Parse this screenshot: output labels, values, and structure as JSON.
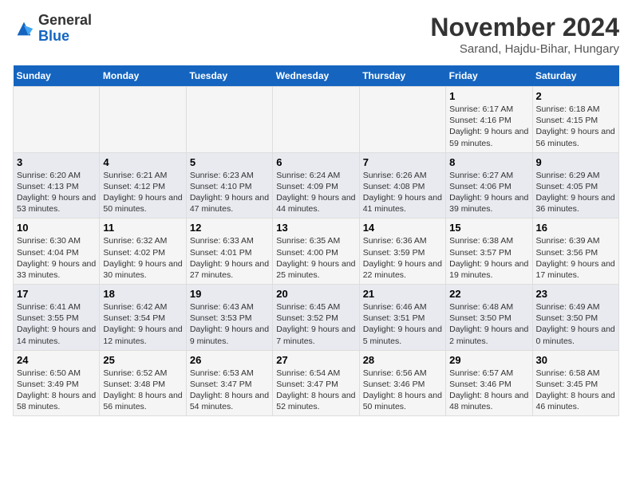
{
  "logo": {
    "general": "General",
    "blue": "Blue"
  },
  "header": {
    "month": "November 2024",
    "location": "Sarand, Hajdu-Bihar, Hungary"
  },
  "weekdays": [
    "Sunday",
    "Monday",
    "Tuesday",
    "Wednesday",
    "Thursday",
    "Friday",
    "Saturday"
  ],
  "weeks": [
    [
      {
        "day": "",
        "info": ""
      },
      {
        "day": "",
        "info": ""
      },
      {
        "day": "",
        "info": ""
      },
      {
        "day": "",
        "info": ""
      },
      {
        "day": "",
        "info": ""
      },
      {
        "day": "1",
        "info": "Sunrise: 6:17 AM\nSunset: 4:16 PM\nDaylight: 9 hours and 59 minutes."
      },
      {
        "day": "2",
        "info": "Sunrise: 6:18 AM\nSunset: 4:15 PM\nDaylight: 9 hours and 56 minutes."
      }
    ],
    [
      {
        "day": "3",
        "info": "Sunrise: 6:20 AM\nSunset: 4:13 PM\nDaylight: 9 hours and 53 minutes."
      },
      {
        "day": "4",
        "info": "Sunrise: 6:21 AM\nSunset: 4:12 PM\nDaylight: 9 hours and 50 minutes."
      },
      {
        "day": "5",
        "info": "Sunrise: 6:23 AM\nSunset: 4:10 PM\nDaylight: 9 hours and 47 minutes."
      },
      {
        "day": "6",
        "info": "Sunrise: 6:24 AM\nSunset: 4:09 PM\nDaylight: 9 hours and 44 minutes."
      },
      {
        "day": "7",
        "info": "Sunrise: 6:26 AM\nSunset: 4:08 PM\nDaylight: 9 hours and 41 minutes."
      },
      {
        "day": "8",
        "info": "Sunrise: 6:27 AM\nSunset: 4:06 PM\nDaylight: 9 hours and 39 minutes."
      },
      {
        "day": "9",
        "info": "Sunrise: 6:29 AM\nSunset: 4:05 PM\nDaylight: 9 hours and 36 minutes."
      }
    ],
    [
      {
        "day": "10",
        "info": "Sunrise: 6:30 AM\nSunset: 4:04 PM\nDaylight: 9 hours and 33 minutes."
      },
      {
        "day": "11",
        "info": "Sunrise: 6:32 AM\nSunset: 4:02 PM\nDaylight: 9 hours and 30 minutes."
      },
      {
        "day": "12",
        "info": "Sunrise: 6:33 AM\nSunset: 4:01 PM\nDaylight: 9 hours and 27 minutes."
      },
      {
        "day": "13",
        "info": "Sunrise: 6:35 AM\nSunset: 4:00 PM\nDaylight: 9 hours and 25 minutes."
      },
      {
        "day": "14",
        "info": "Sunrise: 6:36 AM\nSunset: 3:59 PM\nDaylight: 9 hours and 22 minutes."
      },
      {
        "day": "15",
        "info": "Sunrise: 6:38 AM\nSunset: 3:57 PM\nDaylight: 9 hours and 19 minutes."
      },
      {
        "day": "16",
        "info": "Sunrise: 6:39 AM\nSunset: 3:56 PM\nDaylight: 9 hours and 17 minutes."
      }
    ],
    [
      {
        "day": "17",
        "info": "Sunrise: 6:41 AM\nSunset: 3:55 PM\nDaylight: 9 hours and 14 minutes."
      },
      {
        "day": "18",
        "info": "Sunrise: 6:42 AM\nSunset: 3:54 PM\nDaylight: 9 hours and 12 minutes."
      },
      {
        "day": "19",
        "info": "Sunrise: 6:43 AM\nSunset: 3:53 PM\nDaylight: 9 hours and 9 minutes."
      },
      {
        "day": "20",
        "info": "Sunrise: 6:45 AM\nSunset: 3:52 PM\nDaylight: 9 hours and 7 minutes."
      },
      {
        "day": "21",
        "info": "Sunrise: 6:46 AM\nSunset: 3:51 PM\nDaylight: 9 hours and 5 minutes."
      },
      {
        "day": "22",
        "info": "Sunrise: 6:48 AM\nSunset: 3:50 PM\nDaylight: 9 hours and 2 minutes."
      },
      {
        "day": "23",
        "info": "Sunrise: 6:49 AM\nSunset: 3:50 PM\nDaylight: 9 hours and 0 minutes."
      }
    ],
    [
      {
        "day": "24",
        "info": "Sunrise: 6:50 AM\nSunset: 3:49 PM\nDaylight: 8 hours and 58 minutes."
      },
      {
        "day": "25",
        "info": "Sunrise: 6:52 AM\nSunset: 3:48 PM\nDaylight: 8 hours and 56 minutes."
      },
      {
        "day": "26",
        "info": "Sunrise: 6:53 AM\nSunset: 3:47 PM\nDaylight: 8 hours and 54 minutes."
      },
      {
        "day": "27",
        "info": "Sunrise: 6:54 AM\nSunset: 3:47 PM\nDaylight: 8 hours and 52 minutes."
      },
      {
        "day": "28",
        "info": "Sunrise: 6:56 AM\nSunset: 3:46 PM\nDaylight: 8 hours and 50 minutes."
      },
      {
        "day": "29",
        "info": "Sunrise: 6:57 AM\nSunset: 3:46 PM\nDaylight: 8 hours and 48 minutes."
      },
      {
        "day": "30",
        "info": "Sunrise: 6:58 AM\nSunset: 3:45 PM\nDaylight: 8 hours and 46 minutes."
      }
    ]
  ]
}
